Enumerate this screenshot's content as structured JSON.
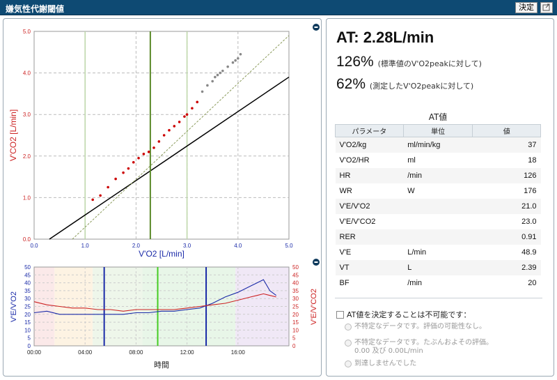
{
  "window": {
    "title": "嫌気性代謝閾値",
    "confirm_label": "決定"
  },
  "top_chart": {
    "xlabel": "V'O2 [L/min]",
    "ylabel": "V'CO2 [L/min]",
    "x_ticks": [
      "0.0",
      "1.0",
      "2.0",
      "3.0",
      "4.0",
      "5.0"
    ],
    "y_ticks": [
      "0.0",
      "1.0",
      "2.0",
      "3.0",
      "4.0",
      "5.0"
    ]
  },
  "bottom_chart": {
    "xlabel": "時間",
    "ylabel_left": "V'E/V'O2",
    "ylabel_right": "V'E/V'CO2",
    "x_ticks": [
      "00:00",
      "04:00",
      "08:00",
      "12:00",
      "16:00"
    ],
    "y_ticks_left": [
      "0",
      "5",
      "10",
      "15",
      "20",
      "25",
      "30",
      "35",
      "40",
      "45",
      "50"
    ],
    "y_ticks_right": [
      "0",
      "5",
      "10",
      "15",
      "20",
      "25",
      "30",
      "35",
      "40",
      "45",
      "50"
    ]
  },
  "summary": {
    "at_text": "AT: 2.28L/min",
    "pct1": "126%",
    "pct1_note": "(標準値のV'O2peakに対して)",
    "pct2": "62%",
    "pct2_note": "(測定したV'O2peakに対して)"
  },
  "at_table": {
    "title": "AT値",
    "headers": [
      "パラメータ",
      "単位",
      "値"
    ],
    "rows": [
      {
        "param": "V'O2/kg",
        "unit": "ml/min/kg",
        "value": "37"
      },
      {
        "param": "V'O2/HR",
        "unit": "ml",
        "value": "18"
      },
      {
        "param": "HR",
        "unit": "/min",
        "value": "126"
      },
      {
        "param": "WR",
        "unit": "W",
        "value": "176"
      },
      {
        "param": "V'E/V'O2",
        "unit": "",
        "value": "21.0"
      },
      {
        "param": "V'E/V'CO2",
        "unit": "",
        "value": "23.0"
      },
      {
        "param": "RER",
        "unit": "",
        "value": "0.91"
      },
      {
        "param": "V'E",
        "unit": "L/min",
        "value": "48.9"
      },
      {
        "param": "VT",
        "unit": "L",
        "value": "2.39"
      },
      {
        "param": "BF",
        "unit": "/min",
        "value": "20"
      }
    ]
  },
  "cannot_determine": {
    "label": "AT値を決定することは不可能です：",
    "options": [
      "不特定なデータです。評価の可能性なし。",
      "不特定なデータです。たぶんおよその評価。",
      "0.00 及び 0.00L/min",
      "到達しませんでした"
    ]
  },
  "chart_data": [
    {
      "type": "scatter",
      "xlabel": "V'O2 [L/min]",
      "ylabel": "V'CO2 [L/min]",
      "xlim": [
        0,
        5
      ],
      "ylim": [
        0,
        5
      ],
      "grid": true,
      "at_marker_x": 2.28,
      "series": [
        {
          "color": "#cc0000",
          "points": [
            [
              1.15,
              0.95
            ],
            [
              1.3,
              1.05
            ],
            [
              1.45,
              1.25
            ],
            [
              1.6,
              1.45
            ],
            [
              1.75,
              1.6
            ],
            [
              1.85,
              1.7
            ],
            [
              1.95,
              1.85
            ],
            [
              2.05,
              1.95
            ],
            [
              2.15,
              2.05
            ],
            [
              2.25,
              2.1
            ],
            [
              2.35,
              2.2
            ],
            [
              2.45,
              2.35
            ],
            [
              2.55,
              2.5
            ],
            [
              2.65,
              2.62
            ],
            [
              2.75,
              2.72
            ],
            [
              2.85,
              2.82
            ],
            [
              2.95,
              2.95
            ],
            [
              3.0,
              3.0
            ],
            [
              3.1,
              3.15
            ],
            [
              3.2,
              3.3
            ]
          ]
        },
        {
          "color": "#888888",
          "points": [
            [
              3.3,
              3.55
            ],
            [
              3.4,
              3.7
            ],
            [
              3.5,
              3.8
            ],
            [
              3.6,
              3.95
            ],
            [
              3.7,
              4.05
            ],
            [
              3.8,
              4.15
            ],
            [
              3.9,
              4.25
            ],
            [
              4.0,
              4.35
            ],
            [
              4.05,
              4.45
            ],
            [
              3.95,
              4.3
            ],
            [
              3.55,
              3.9
            ],
            [
              3.65,
              4.0
            ]
          ]
        }
      ],
      "lines": [
        {
          "name": "S1",
          "color": "#000000",
          "x": [
            0.3,
            5.0
          ],
          "y": [
            0.0,
            3.9
          ]
        },
        {
          "name": "S2",
          "color": "#8a9a5a",
          "x": [
            0.75,
            5.0
          ],
          "y": [
            0.0,
            4.9
          ]
        }
      ]
    },
    {
      "type": "line",
      "xlabel": "時間",
      "ylabel": "V'E/V'O2",
      "ylabel_right": "V'E/V'CO2",
      "xlim": [
        0,
        20
      ],
      "ylim": [
        0,
        50
      ],
      "grid": true,
      "x_tick_labels": [
        "00:00",
        "04:00",
        "08:00",
        "12:00",
        "16:00"
      ],
      "x": [
        0,
        1,
        2,
        3,
        4,
        5,
        6,
        7,
        8,
        9,
        10,
        11,
        12,
        13,
        14,
        15,
        16,
        17,
        17.5,
        18,
        18.5,
        19
      ],
      "series": [
        {
          "color": "#1a2aa8",
          "values": [
            21,
            22,
            20,
            20,
            20,
            20,
            20,
            20,
            21,
            21,
            22,
            22,
            23,
            24,
            27,
            31,
            34,
            38,
            40,
            42,
            35,
            32
          ]
        },
        {
          "color": "#cc2222",
          "values": [
            28,
            26,
            25,
            24,
            24,
            23,
            23,
            22,
            23,
            23,
            23,
            23,
            24,
            25,
            26,
            27,
            29,
            31,
            32,
            33,
            32,
            31
          ]
        }
      ],
      "shaded_regions": [
        {
          "x0": 0,
          "x1": 1.6,
          "color": "#fbe9e9"
        },
        {
          "x0": 1.6,
          "x1": 4.6,
          "color": "#fdf3e3"
        },
        {
          "x0": 4.6,
          "x1": 8.5,
          "color": "#eef6ea"
        },
        {
          "x0": 8.5,
          "x1": 15.8,
          "color": "#e8f6e8"
        },
        {
          "x0": 15.8,
          "x1": 20,
          "color": "#f0e8f6"
        }
      ],
      "vertical_markers": [
        {
          "x": 5.5,
          "color": "#1a2aa8"
        },
        {
          "x": 9.7,
          "color": "#44cc22"
        },
        {
          "x": 13.5,
          "color": "#1a2aa8"
        }
      ]
    }
  ]
}
